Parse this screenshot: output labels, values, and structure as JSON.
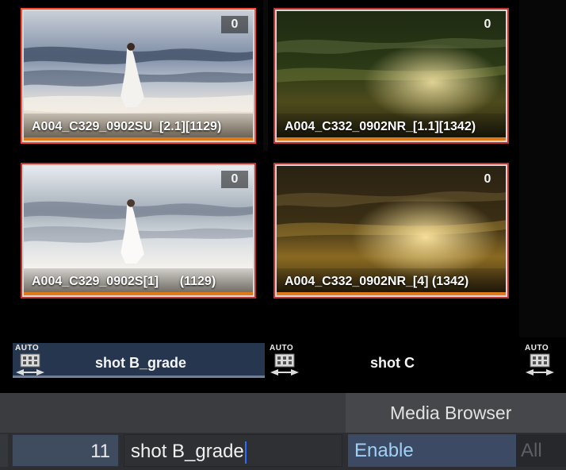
{
  "thumbnails": [
    {
      "name": "A004_C329_0902SU_[2.1][1129)",
      "count": "0",
      "count_plain": false,
      "selected": true
    },
    {
      "name": "A004_C332_0902NR_[1.1][1342)",
      "count": "0",
      "count_plain": true,
      "selected": false
    },
    {
      "name": "A004_C329_0902S[1]      (1129)",
      "count": "0",
      "count_plain": false,
      "selected": false
    },
    {
      "name": "A004_C332_0902NR_[4] (1342)",
      "count": "0",
      "count_plain": true,
      "selected": false
    }
  ],
  "shots": {
    "auto_label": "AUTO",
    "items": [
      {
        "name": "shot B_grade",
        "active": true
      },
      {
        "name": "shot C",
        "active": false
      }
    ]
  },
  "panel": {
    "media_browser_label": "Media Browser",
    "number_value": "11",
    "name_value": "shot B_grade",
    "enable_label": "Enable",
    "all_label": "All"
  },
  "colors": {
    "selection_outline": "#ff4936",
    "active_shot_bg": "#26364f",
    "enable_text": "#9fd0f5"
  }
}
